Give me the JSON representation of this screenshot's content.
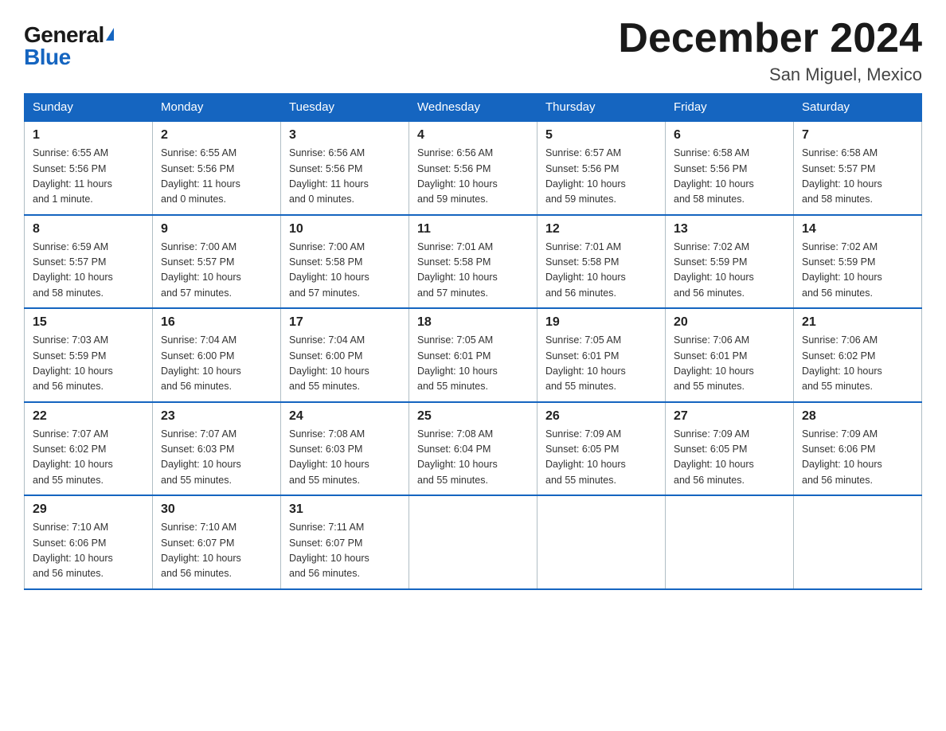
{
  "logo": {
    "general": "General",
    "blue": "Blue",
    "triangle": "▶"
  },
  "title": "December 2024",
  "location": "San Miguel, Mexico",
  "days_of_week": [
    "Sunday",
    "Monday",
    "Tuesday",
    "Wednesday",
    "Thursday",
    "Friday",
    "Saturday"
  ],
  "weeks": [
    [
      {
        "day": "1",
        "info": "Sunrise: 6:55 AM\nSunset: 5:56 PM\nDaylight: 11 hours\nand 1 minute."
      },
      {
        "day": "2",
        "info": "Sunrise: 6:55 AM\nSunset: 5:56 PM\nDaylight: 11 hours\nand 0 minutes."
      },
      {
        "day": "3",
        "info": "Sunrise: 6:56 AM\nSunset: 5:56 PM\nDaylight: 11 hours\nand 0 minutes."
      },
      {
        "day": "4",
        "info": "Sunrise: 6:56 AM\nSunset: 5:56 PM\nDaylight: 10 hours\nand 59 minutes."
      },
      {
        "day": "5",
        "info": "Sunrise: 6:57 AM\nSunset: 5:56 PM\nDaylight: 10 hours\nand 59 minutes."
      },
      {
        "day": "6",
        "info": "Sunrise: 6:58 AM\nSunset: 5:56 PM\nDaylight: 10 hours\nand 58 minutes."
      },
      {
        "day": "7",
        "info": "Sunrise: 6:58 AM\nSunset: 5:57 PM\nDaylight: 10 hours\nand 58 minutes."
      }
    ],
    [
      {
        "day": "8",
        "info": "Sunrise: 6:59 AM\nSunset: 5:57 PM\nDaylight: 10 hours\nand 58 minutes."
      },
      {
        "day": "9",
        "info": "Sunrise: 7:00 AM\nSunset: 5:57 PM\nDaylight: 10 hours\nand 57 minutes."
      },
      {
        "day": "10",
        "info": "Sunrise: 7:00 AM\nSunset: 5:58 PM\nDaylight: 10 hours\nand 57 minutes."
      },
      {
        "day": "11",
        "info": "Sunrise: 7:01 AM\nSunset: 5:58 PM\nDaylight: 10 hours\nand 57 minutes."
      },
      {
        "day": "12",
        "info": "Sunrise: 7:01 AM\nSunset: 5:58 PM\nDaylight: 10 hours\nand 56 minutes."
      },
      {
        "day": "13",
        "info": "Sunrise: 7:02 AM\nSunset: 5:59 PM\nDaylight: 10 hours\nand 56 minutes."
      },
      {
        "day": "14",
        "info": "Sunrise: 7:02 AM\nSunset: 5:59 PM\nDaylight: 10 hours\nand 56 minutes."
      }
    ],
    [
      {
        "day": "15",
        "info": "Sunrise: 7:03 AM\nSunset: 5:59 PM\nDaylight: 10 hours\nand 56 minutes."
      },
      {
        "day": "16",
        "info": "Sunrise: 7:04 AM\nSunset: 6:00 PM\nDaylight: 10 hours\nand 56 minutes."
      },
      {
        "day": "17",
        "info": "Sunrise: 7:04 AM\nSunset: 6:00 PM\nDaylight: 10 hours\nand 55 minutes."
      },
      {
        "day": "18",
        "info": "Sunrise: 7:05 AM\nSunset: 6:01 PM\nDaylight: 10 hours\nand 55 minutes."
      },
      {
        "day": "19",
        "info": "Sunrise: 7:05 AM\nSunset: 6:01 PM\nDaylight: 10 hours\nand 55 minutes."
      },
      {
        "day": "20",
        "info": "Sunrise: 7:06 AM\nSunset: 6:01 PM\nDaylight: 10 hours\nand 55 minutes."
      },
      {
        "day": "21",
        "info": "Sunrise: 7:06 AM\nSunset: 6:02 PM\nDaylight: 10 hours\nand 55 minutes."
      }
    ],
    [
      {
        "day": "22",
        "info": "Sunrise: 7:07 AM\nSunset: 6:02 PM\nDaylight: 10 hours\nand 55 minutes."
      },
      {
        "day": "23",
        "info": "Sunrise: 7:07 AM\nSunset: 6:03 PM\nDaylight: 10 hours\nand 55 minutes."
      },
      {
        "day": "24",
        "info": "Sunrise: 7:08 AM\nSunset: 6:03 PM\nDaylight: 10 hours\nand 55 minutes."
      },
      {
        "day": "25",
        "info": "Sunrise: 7:08 AM\nSunset: 6:04 PM\nDaylight: 10 hours\nand 55 minutes."
      },
      {
        "day": "26",
        "info": "Sunrise: 7:09 AM\nSunset: 6:05 PM\nDaylight: 10 hours\nand 55 minutes."
      },
      {
        "day": "27",
        "info": "Sunrise: 7:09 AM\nSunset: 6:05 PM\nDaylight: 10 hours\nand 56 minutes."
      },
      {
        "day": "28",
        "info": "Sunrise: 7:09 AM\nSunset: 6:06 PM\nDaylight: 10 hours\nand 56 minutes."
      }
    ],
    [
      {
        "day": "29",
        "info": "Sunrise: 7:10 AM\nSunset: 6:06 PM\nDaylight: 10 hours\nand 56 minutes."
      },
      {
        "day": "30",
        "info": "Sunrise: 7:10 AM\nSunset: 6:07 PM\nDaylight: 10 hours\nand 56 minutes."
      },
      {
        "day": "31",
        "info": "Sunrise: 7:11 AM\nSunset: 6:07 PM\nDaylight: 10 hours\nand 56 minutes."
      },
      null,
      null,
      null,
      null
    ]
  ]
}
